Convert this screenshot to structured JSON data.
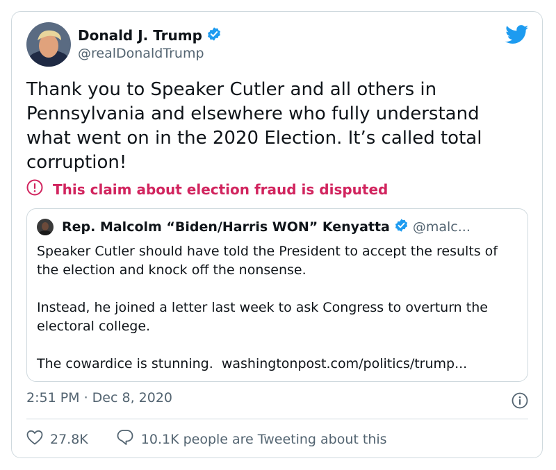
{
  "author": {
    "name": "Donald J. Trump",
    "handle": "@realDonaldTrump",
    "verified": true
  },
  "tweet": {
    "text": "Thank you to Speaker Cutler and all others in Pennsylvania and elsewhere who fully understand what went on in the 2020 Election. It’s called total corruption!"
  },
  "dispute": {
    "label": "This claim about election fraud is disputed",
    "icon": "alert-circle-icon",
    "color": "#d1245e"
  },
  "quote": {
    "name": "Rep. Malcolm “Biden/Harris WON” Kenyatta",
    "handle": "@malc...",
    "verified": true,
    "paragraph1": "Speaker Cutler should have told the President to accept the results of the election and knock off the nonsense.",
    "paragraph2": "Instead, he joined a letter last week to ask Congress to overturn the electoral college.",
    "paragraph3_text": "The cowardice is stunning.  ",
    "paragraph3_link": "washingtonpost.com/politics/trump..."
  },
  "meta": {
    "timestamp": "2:51 PM · Dec 8, 2020"
  },
  "actions": {
    "likes": "27.8K",
    "replies_label": "10.1K people are Tweeting about this"
  },
  "colors": {
    "accent": "#1d9bf0",
    "secondary_text": "#536471",
    "border": "#cfd9de"
  }
}
